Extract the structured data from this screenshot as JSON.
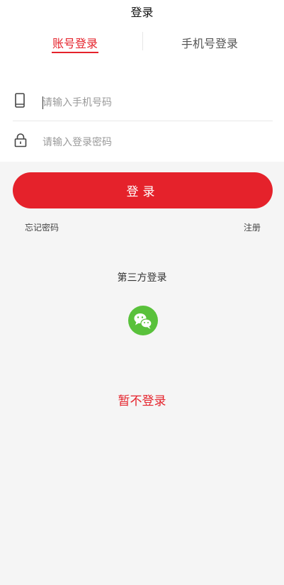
{
  "header": {
    "title": "登录"
  },
  "tabs": [
    {
      "label": "账号登录",
      "active": true
    },
    {
      "label": "手机号登录",
      "active": false
    }
  ],
  "form": {
    "phone_placeholder": "请输入手机号码",
    "password_placeholder": "请输入登录密码",
    "phone_icon": "phone-icon",
    "lock_icon": "lock-icon"
  },
  "actions": {
    "login_label": "登录",
    "forgot_label": "忘记密码",
    "register_label": "注册"
  },
  "third_party": {
    "title": "第三方登录",
    "icon": "wechat-icon"
  },
  "skip": {
    "label": "暂不登录"
  },
  "colors": {
    "accent": "#e5222b",
    "wechat": "#59c13b",
    "background": "#f5f5f5"
  }
}
